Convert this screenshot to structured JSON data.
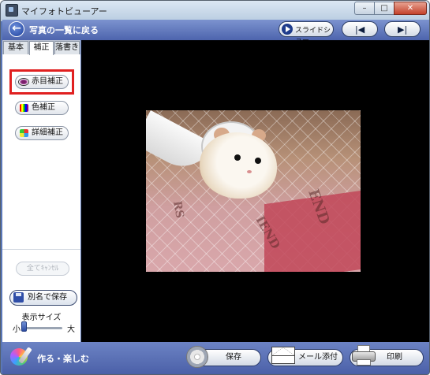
{
  "window": {
    "title": "マイフォトビューアー",
    "controls": {
      "minimize": "–",
      "maximize": "□",
      "close": "✕"
    }
  },
  "header": {
    "back_label": "写真の一覧に戻る",
    "back_icon": "arrow-left-icon",
    "slideshow_label": "スライドショー",
    "prev_label": "|◀",
    "next_label": "▶|"
  },
  "left_panel": {
    "tabs": [
      {
        "label": "基本",
        "selected": false
      },
      {
        "label": "補正",
        "selected": true
      },
      {
        "label": "落書き",
        "selected": false
      }
    ],
    "tools": [
      {
        "label": "赤目補正",
        "icon": "red-eye-icon",
        "highlighted": true
      },
      {
        "label": "色補正",
        "icon": "color-bars-icon",
        "highlighted": false
      },
      {
        "label": "詳細補正",
        "icon": "detail-adjust-icon",
        "highlighted": false
      }
    ],
    "cancel_all_label": "全てｷｬﾝｾﾙ",
    "save_as_label": "別名で保存",
    "display_size_label": "表示サイズ",
    "size_small_label": "小",
    "size_large_label": "大"
  },
  "bottom_bar": {
    "make_label": "作る・楽しむ",
    "save_label": "保存",
    "mail_label": "メール添付",
    "print_label": "印刷"
  },
  "colors": {
    "accent_blue": "#4d64ad",
    "highlight_red": "#e02020",
    "viewer_background": "#000000"
  }
}
